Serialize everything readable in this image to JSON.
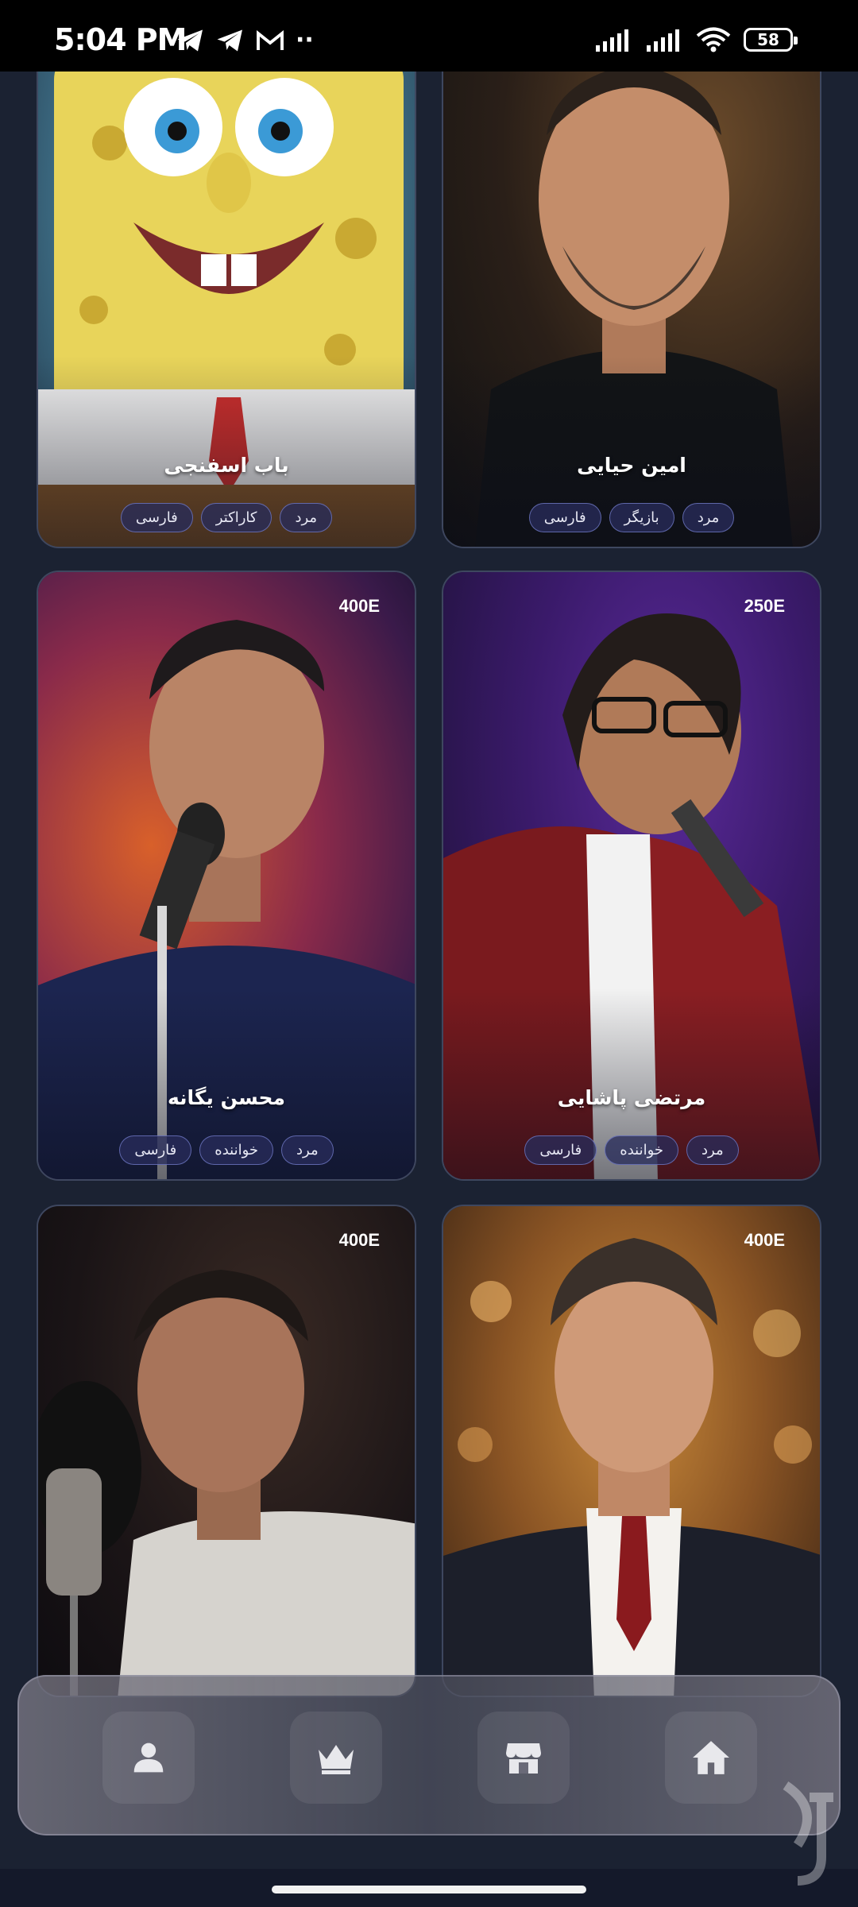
{
  "status_bar": {
    "time": "5:04 PM",
    "battery": "58",
    "left_icons": [
      "telegram-icon",
      "telegram-icon",
      "gmail-icon",
      "more-dots-icon"
    ],
    "right_icons": [
      "signal-icon",
      "signal-icon",
      "wifi-icon",
      "battery-icon"
    ]
  },
  "cards": [
    {
      "name": "باب اسفنجی",
      "price": "",
      "tags": [
        "مرد",
        "کاراکتر",
        "فارسی"
      ]
    },
    {
      "name": "امین حیایی",
      "price": "",
      "tags": [
        "مرد",
        "بازیگر",
        "فارسی"
      ]
    },
    {
      "name": "محسن یگانه",
      "price": "400E",
      "tags": [
        "مرد",
        "خواننده",
        "فارسی"
      ]
    },
    {
      "name": "مرتضی پاشایی",
      "price": "250E",
      "tags": [
        "مرد",
        "خواننده",
        "فارسی"
      ]
    },
    {
      "name": "",
      "price": "400E",
      "tags": []
    },
    {
      "name": "",
      "price": "400E",
      "tags": []
    }
  ],
  "bottom_nav": {
    "items": [
      "profile-icon",
      "crown-icon",
      "store-icon",
      "home-icon"
    ]
  },
  "colors": {
    "background": "#1b2232",
    "tag_bg": "#282c5a",
    "tag_border": "#7882d2"
  }
}
